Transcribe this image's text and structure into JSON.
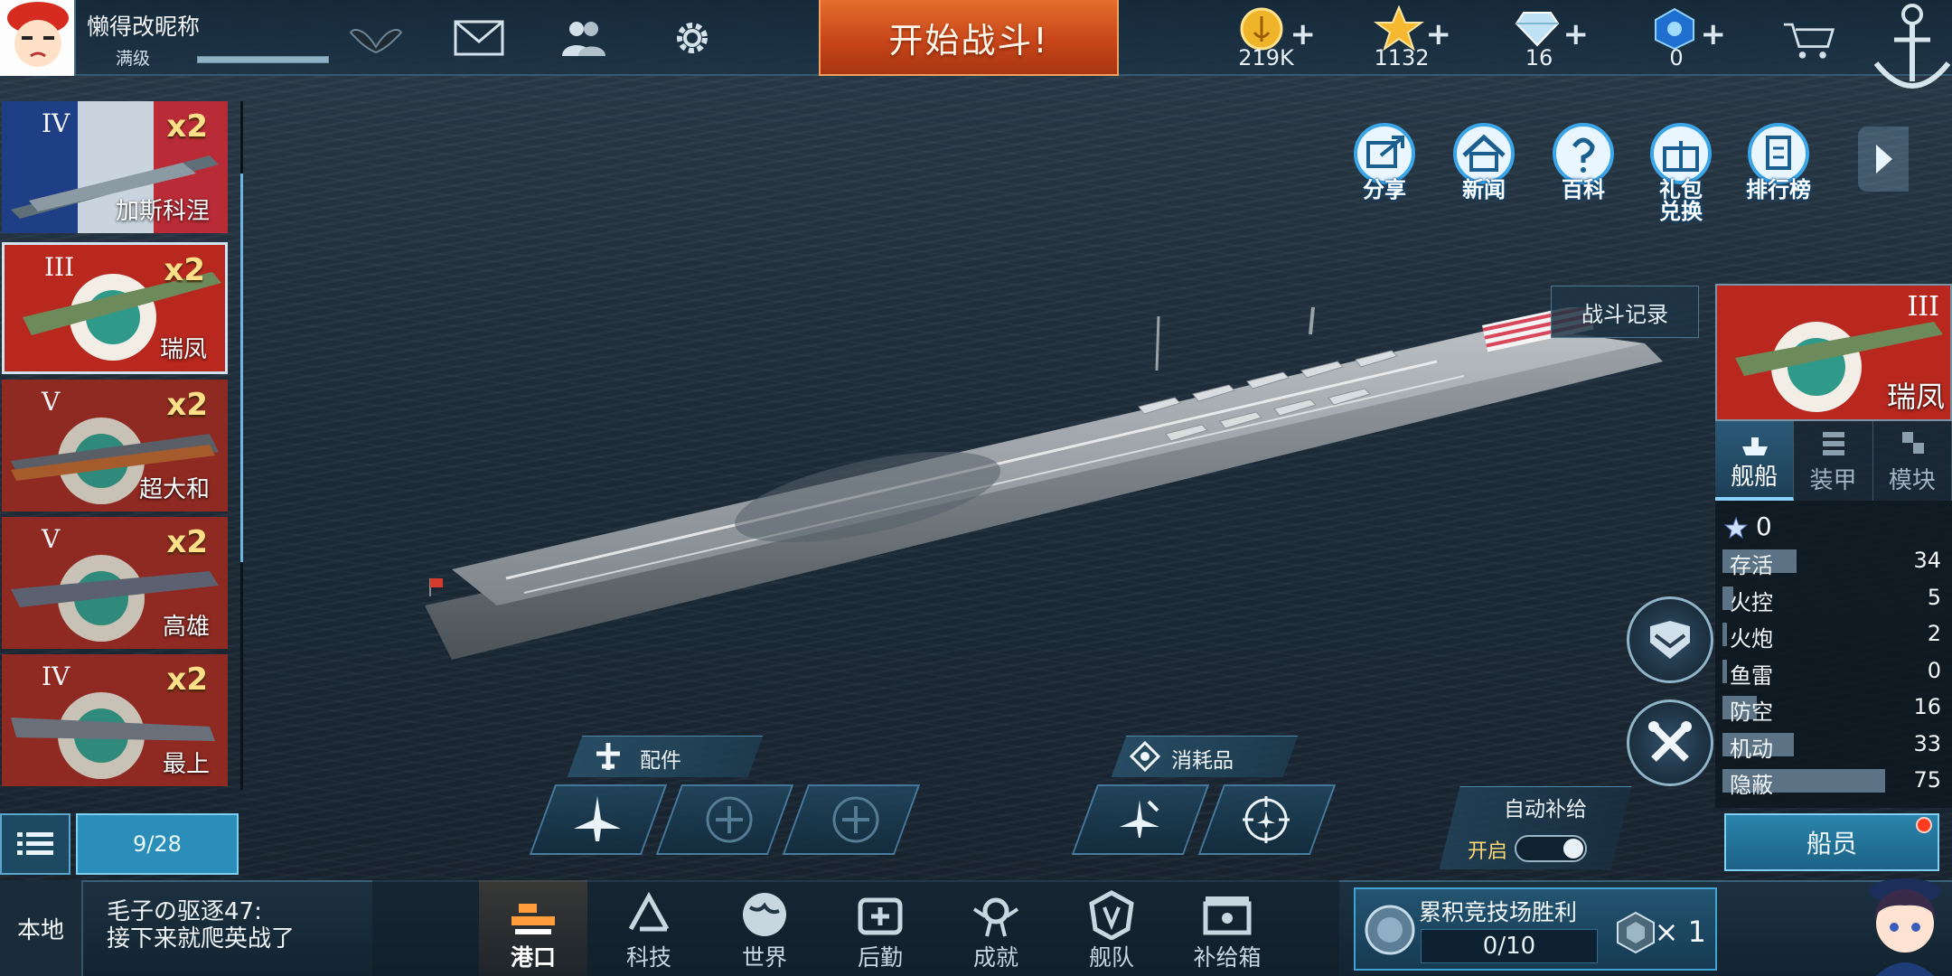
{
  "player": {
    "name": "懒得改昵称",
    "level": "满级",
    "xp_fraction": 1.0
  },
  "start_battle": "开始战斗!",
  "currencies": [
    {
      "icon": "gold-coin-icon",
      "value": "219K"
    },
    {
      "icon": "gold-star-icon",
      "value": "1132"
    },
    {
      "icon": "diamond-icon",
      "value": "16"
    },
    {
      "icon": "blue-medal-icon",
      "value": "0"
    }
  ],
  "top_menu": [
    {
      "label": "分享",
      "icon": "share-icon"
    },
    {
      "label": "新闻",
      "icon": "news-house-icon"
    },
    {
      "label": "百科",
      "icon": "encyclopedia-icon"
    },
    {
      "label": "礼包\n兑换",
      "icon": "gift-redeem-icon"
    },
    {
      "label": "排行榜",
      "icon": "leaderboard-icon"
    }
  ],
  "ships": [
    {
      "tier": "IV",
      "mult": "x2",
      "name": "加斯科涅",
      "flag": "france"
    },
    {
      "tier": "III",
      "mult": "x2",
      "name": "瑞凤",
      "flag": "japan"
    },
    {
      "tier": "V",
      "mult": "x2",
      "name": "超大和",
      "flag": "japan"
    },
    {
      "tier": "V",
      "mult": "x2",
      "name": "高雄",
      "flag": "japan"
    },
    {
      "tier": "IV",
      "mult": "x2",
      "name": "最上",
      "flag": "japan"
    }
  ],
  "ship_count": "9/28",
  "battle_log": "战斗记录",
  "selected_ship": {
    "name": "瑞凤",
    "tier": "III",
    "tabs": [
      "舰船",
      "装甲",
      "模块"
    ],
    "stars": "0",
    "stats": [
      {
        "name": "存活",
        "value": "34",
        "max": 75
      },
      {
        "name": "火控",
        "value": "5",
        "max": 75
      },
      {
        "name": "火炮",
        "value": "2",
        "max": 75
      },
      {
        "name": "鱼雷",
        "value": "0",
        "max": 75
      },
      {
        "name": "防空",
        "value": "16",
        "max": 75
      },
      {
        "name": "机动",
        "value": "33",
        "max": 75
      },
      {
        "name": "隐蔽",
        "value": "75",
        "max": 75
      }
    ]
  },
  "crew_label": "船员",
  "equipment": {
    "parts_label": "配件",
    "consumables_label": "消耗品"
  },
  "auto_supply": {
    "label": "自动补给",
    "state": "开启"
  },
  "bottom": {
    "local": "本地",
    "chat_lines": [
      "毛子の驱逐47:",
      "接下来就爬英战了"
    ],
    "nav": [
      {
        "label": "港口",
        "icon": "port-icon",
        "active": true
      },
      {
        "label": "科技",
        "icon": "tech-icon",
        "active": false
      },
      {
        "label": "世界",
        "icon": "world-globe-icon",
        "active": false
      },
      {
        "label": "后勤",
        "icon": "logistics-icon",
        "active": false
      },
      {
        "label": "成就",
        "icon": "achievement-icon",
        "active": false
      },
      {
        "label": "舰队",
        "icon": "fleet-icon",
        "active": false
      },
      {
        "label": "补给箱",
        "icon": "supply-box-icon",
        "active": false
      }
    ],
    "arena": {
      "title": "累积竞技场胜利",
      "progress": "0/10",
      "mult": "× 1"
    }
  }
}
